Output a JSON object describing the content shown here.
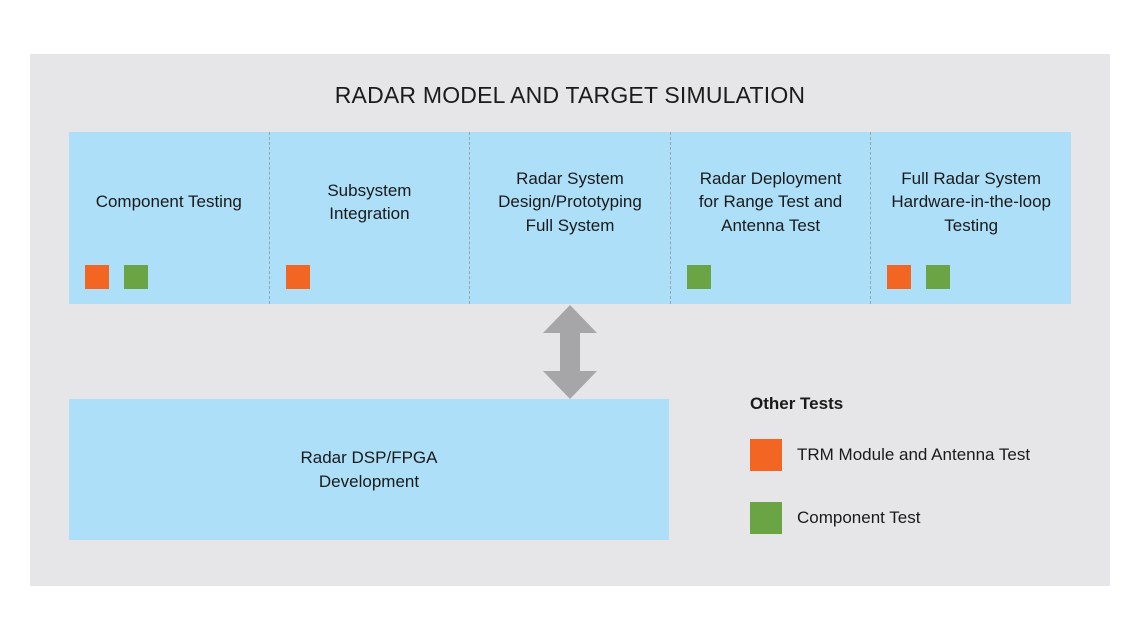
{
  "title": "RADAR MODEL AND TARGET SIMULATION",
  "colors": {
    "trm": "#f26522",
    "component": "#6aa444",
    "box": "#addff8",
    "panel": "#e6e6e8",
    "arrow": "#a6a6a8"
  },
  "stages": [
    {
      "label": "Component Testing",
      "markers": [
        "trm",
        "component"
      ]
    },
    {
      "label": "Subsystem\nIntegration",
      "markers": [
        "trm"
      ]
    },
    {
      "label": "Radar System\nDesign/Prototyping\nFull System",
      "markers": []
    },
    {
      "label": "Radar Deployment\nfor Range Test and\nAntenna Test",
      "markers": [
        "component"
      ]
    },
    {
      "label": "Full Radar System\nHardware-in-the-loop\nTesting",
      "markers": [
        "trm",
        "component"
      ]
    }
  ],
  "dsp_box": {
    "label": "Radar DSP/FPGA\nDevelopment"
  },
  "arrow": {
    "icon": "double-headed-vertical-arrow"
  },
  "legend": {
    "title": "Other Tests",
    "items": [
      {
        "key": "trm",
        "label": "TRM Module and Antenna Test"
      },
      {
        "key": "component",
        "label": "Component Test"
      }
    ]
  }
}
